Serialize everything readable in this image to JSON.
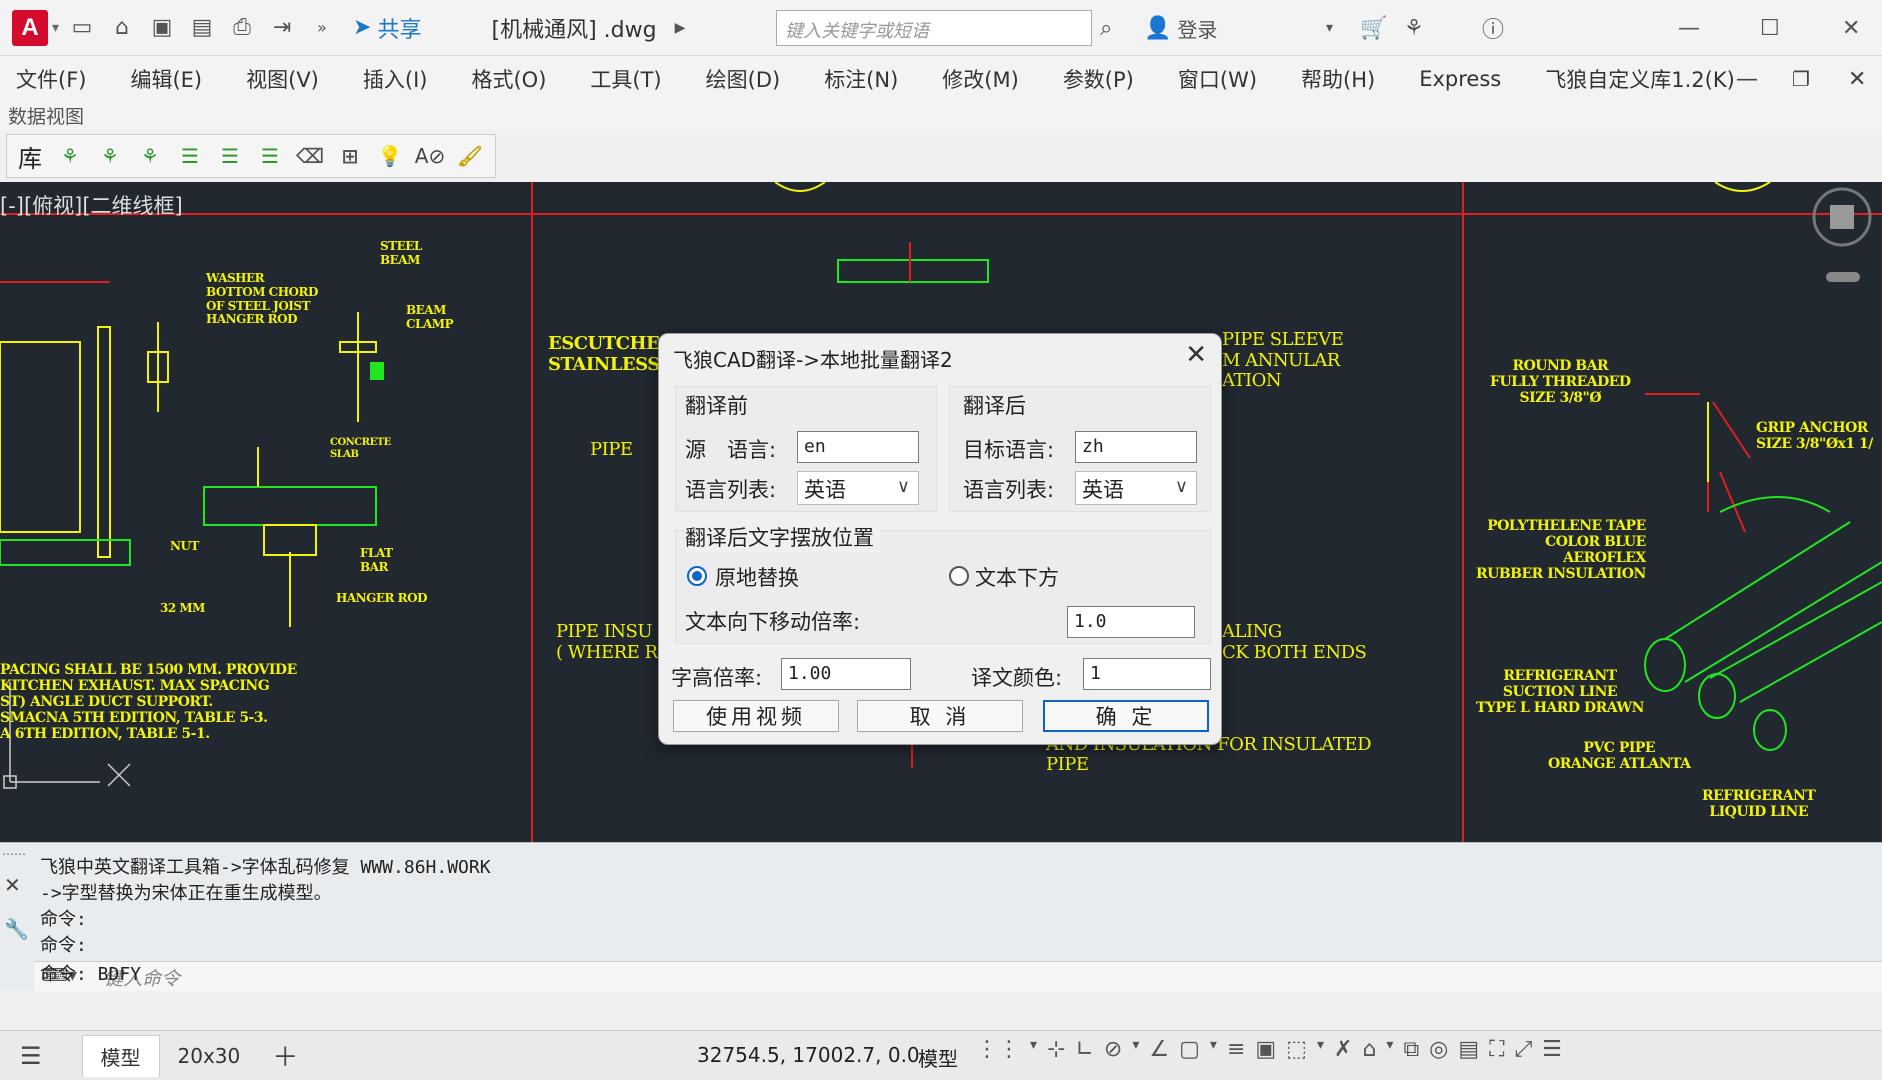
{
  "app": {
    "icon_letter": "A",
    "doc_title": "[机械通风] .dwg",
    "share_label": "共享"
  },
  "search": {
    "placeholder": "键入关键字或短语"
  },
  "account": {
    "login_label": "登录"
  },
  "menu": [
    "文件(F)",
    "编辑(E)",
    "视图(V)",
    "插入(I)",
    "格式(O)",
    "工具(T)",
    "绘图(D)",
    "标注(N)",
    "修改(M)",
    "参数(P)",
    "窗口(W)",
    "帮助(H)",
    "Express",
    "飞狼自定义库1.2(K)"
  ],
  "subbar": {
    "label": "数据视图"
  },
  "toolbar": {
    "lib_label": "库"
  },
  "viewport": {
    "label": "[-][俯视][二维线框]"
  },
  "drawing_texts": {
    "steel_beam": "STEEL\nBEAM",
    "washer": "WASHER\nBOTTOM CHORD\nOF STEEL JOIST\nHANGER ROD",
    "beam_clamp": "BEAM\nCLAMP",
    "concrete_slab": "CONCRETE\nSLAB",
    "nut": "NUT",
    "flat_bar": "FLAT\nBAR",
    "hanger_rod": "HANGER ROD",
    "mm32": "32 MM",
    "spacing_note": "PACING SHALL BE 1500 MM. PROVIDE\nKITCHEN EXHAUST. MAX SPACING\nST) ANGLE DUCT SUPPORT.\nSMACNA 5TH EDITION, TABLE 5-3.\nA 6TH EDITION, TABLE 5-1.",
    "escutcheon": "ESCUTCHEO\nSTAINLESS",
    "pipe1": "PIPE",
    "pipe_insul": "PIPE INSU\n( WHERE R",
    "pipe_sleeve": "PIPE SLEEVE\nM ANNULAR\nATION",
    "sealing": "ALING\nCK BOTH ENDS",
    "bare_pipe": "R BARE PIPE\nAND INSULATION FOR INSULATED\nPIPE",
    "round_bar": "ROUND BAR\nFULLY THREADED\nSIZE 3/8\"Ø",
    "grip_anchor": "GRIP ANCHOR\nSIZE 3/8\"Øx1 1/",
    "polyethylene": "POLYTHELENE TAPE\nCOLOR BLUE\nAEROFLEX\nRUBBER INSULATION",
    "refrigerant_suction": "REFRIGERANT\nSUCTION LINE\nTYPE L HARD DRAWN",
    "pvc_pipe": "PVC PIPE\nORANGE ATLANTA",
    "refrigerant_liquid": "REFRIGERANT\nLIQUID LINE"
  },
  "dialog": {
    "title": "飞狼CAD翻译->本地批量翻译2",
    "before_group": "翻译前",
    "after_group": "翻译后",
    "source_lang_label": "源　语言:",
    "source_lang_value": "en",
    "list_label_left": "语言列表:",
    "list_value_left": "英语",
    "target_lang_label": "目标语言:",
    "target_lang_value": "zh",
    "list_label_right": "语言列表:",
    "list_value_right": "英语",
    "placement_group": "翻译后文字摆放位置",
    "radio_inplace": "原地替换",
    "radio_below": "文本下方",
    "move_ratio_label": "文本向下移动倍率:",
    "move_ratio_value": "1.0",
    "height_ratio_label": "字高倍率:",
    "height_ratio_value": "1.00",
    "color_label": "译文颜色:",
    "color_value": "1",
    "btn_video": "使用视频",
    "btn_cancel": "取 消",
    "btn_ok": "确 定"
  },
  "command": {
    "lines": [
      "飞狼中英文翻译工具箱->字体乱码修复 WWW.86H.WORK",
      "->字型替换为宋体正在重生成模型。",
      "命令:",
      "命令:",
      "命令: BDFY"
    ],
    "placeholder": "键入命令"
  },
  "status": {
    "tab_model": "模型",
    "tab_layout": "20x30",
    "coords": "32754.5, 17002.7, 0.0",
    "model_label": "模型"
  },
  "colors": {
    "cad_bg": "#212830",
    "cad_yellow": "#f2f20a",
    "cad_green": "#22e522",
    "cad_red": "#e02020",
    "accent_blue": "#0a64c8"
  }
}
